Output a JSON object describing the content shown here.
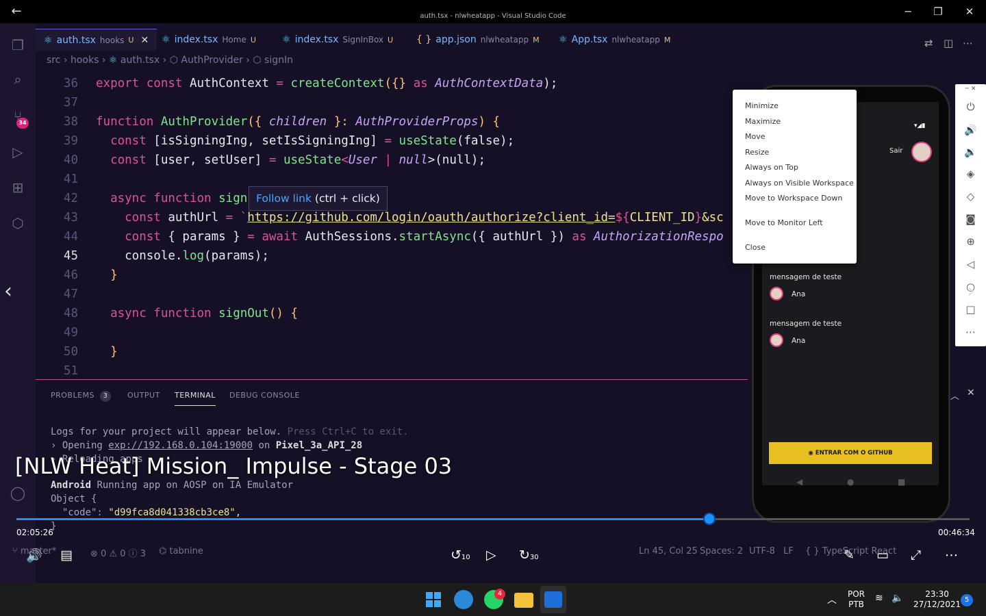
{
  "titlebar": {
    "title": "auth.tsx - nlwheatapp - Visual Studio Code",
    "back": "←",
    "minimize": "─",
    "restore": "❐",
    "close": "✕"
  },
  "activity": {
    "scm_badge": "34"
  },
  "tabs": [
    {
      "name": "auth.tsx",
      "desc": "hooks",
      "status": "U",
      "close": "✕"
    },
    {
      "name": "index.tsx",
      "desc": "Home",
      "status": "U"
    },
    {
      "name": "index.tsx",
      "desc": "SignInBox",
      "status": "U"
    },
    {
      "icon": "{ }",
      "name": "app.json",
      "desc": "nlwheatapp",
      "status": "M"
    },
    {
      "name": "App.tsx",
      "desc": "nlwheatapp",
      "status": "M"
    }
  ],
  "breadcrumb": {
    "a": "src",
    "b": "hooks",
    "c": "auth.tsx",
    "d": "AuthProvider",
    "e": "signIn",
    "sep": " › "
  },
  "code": {
    "lines": [
      "36",
      "37",
      "38",
      "39",
      "40",
      "41",
      "42",
      "43",
      "44",
      "45",
      "46",
      "47",
      "48",
      "49",
      "50",
      "51"
    ],
    "l36": {
      "a": "export ",
      "b": "const ",
      "c": "AuthContext ",
      "d": "= ",
      "e": "createContext",
      "f": "({} ",
      "g": "as ",
      "h": "AuthContextData",
      "i": ");"
    },
    "l38": {
      "a": "function ",
      "b": "AuthProvider",
      "c": "({ ",
      "d": "children ",
      "e": "}: ",
      "f": "AuthProviderProps",
      "g": ") {"
    },
    "l39": {
      "a": "  const ",
      "b": "[isSigningIng, setIsSigningIng] ",
      "c": "= ",
      "d": "useState",
      "e": "(false);"
    },
    "l40": {
      "a": "  const ",
      "b": "[user, setUser] ",
      "c": "= ",
      "d": "useState",
      "e": "<",
      "f": "User ",
      "g": "| ",
      "h": "null",
      "i": ">(null);"
    },
    "l42": {
      "a": "  async ",
      "b": "function ",
      "c": "sign"
    },
    "l43": {
      "a": "    const ",
      "b": "authUrl ",
      "c": "= `",
      "d": "https://github.com/login/oauth/authorize?client_id=",
      "e": "${",
      "f": "CLIENT_ID",
      "g": "}",
      "h": "&sc"
    },
    "l44": {
      "a": "    const ",
      "b": "{ params } ",
      "c": "= ",
      "d": "await ",
      "e": "AuthSessions.",
      "f": "startAsync",
      "g": "({ authUrl }) ",
      "h": "as ",
      "i": "AuthorizationRespo"
    },
    "l45": {
      "a": "    console.",
      "b": "log",
      "c": "(params);"
    },
    "l46": {
      "a": "  }"
    },
    "l48": {
      "a": "  async ",
      "b": "function ",
      "c": "signOut",
      "d": "() {"
    },
    "l50": {
      "a": "  }"
    }
  },
  "tooltip": {
    "link": "Follow link",
    "hint": " (ctrl + click)"
  },
  "panel": {
    "tabs": [
      {
        "label": "PROBLEMS",
        "badge": "3"
      },
      {
        "label": "OUTPUT"
      },
      {
        "label": "TERMINAL"
      },
      {
        "label": "DEBUG CONSOLE"
      }
    ],
    "maximize": "︿",
    "close": "✕",
    "t1a": "Logs for your project will appear below. ",
    "t1b": "Press Ctrl+C to exit.",
    "t2a": "› Opening ",
    "t2b": "exp://192.168.0.104:19000",
    "t2c": " on ",
    "t2d": "Pixel_3a_API_28",
    "t3": "› Reloading apps",
    "t4a": "Android",
    "t4b": " Running app on AOSP on IA Emulator",
    "t5": "Object {",
    "t6a": "  \"code\": ",
    "t6b": "\"d99fca8d041338cb3ce8\",",
    "t7": "}"
  },
  "status": {
    "branch": "master*",
    "errors": "⊗ 0 ⚠ 0 ⓘ 3",
    "tabnine": "tabnine",
    "position": "Ln 45, Col 25",
    "spaces": "Spaces: 2",
    "encoding": "UTF-8",
    "eol": "LF",
    "lang": "{ } TypeScript React"
  },
  "phone": {
    "logout": "Sair",
    "messages": [
      {
        "text": "mensagem de teste",
        "author": "Ana"
      },
      {
        "text": "mensagem de teste",
        "author": "Ana"
      }
    ],
    "github_button": "ENTRAR COM O GITHUB"
  },
  "context_menu": {
    "items": [
      "Minimize",
      "Maximize",
      "Move",
      "Resize",
      "Always on Top",
      "Always on Visible Workspace",
      "Move to Workspace Down",
      "Move to Monitor Left",
      "Close"
    ]
  },
  "video": {
    "title": "[NLW Heat] Mission_ Impulse - Stage 03",
    "current_time": "02:05:26",
    "total_time": "00:46:34",
    "progress": 0.727,
    "rewind": "10",
    "forward": "30"
  },
  "taskbar": {
    "lang1": "POR",
    "lang2": "PTB",
    "time": "23:30",
    "date": "27/12/2021",
    "notif": "5",
    "whatsapp_badge": "4"
  },
  "colors": {
    "accent": "#1e90ff",
    "vscode_bg": "#161026",
    "github_btn": "#e8c021",
    "badge": "#e0207a"
  }
}
